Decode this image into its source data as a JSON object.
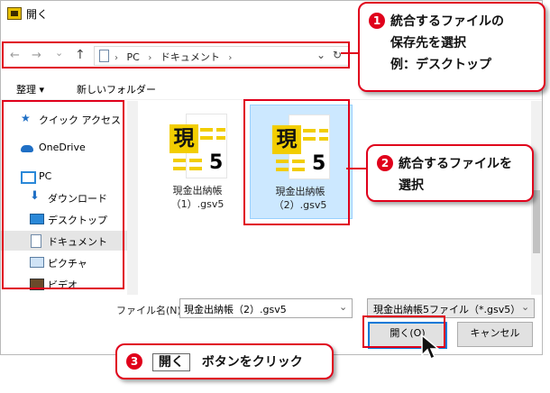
{
  "window": {
    "title": "開く"
  },
  "nav": {
    "back": "←",
    "forward": "→",
    "recent": "⌄",
    "up": "↑",
    "path": [
      "PC",
      "ドキュメント"
    ],
    "sep": "›",
    "dropdown": "⌄",
    "refresh": "↻"
  },
  "toolbar": {
    "organize": "整理 ▾",
    "new_folder": "新しいフォルダー"
  },
  "sidebar": {
    "items": [
      {
        "label": "クイック アクセス",
        "icon": "star-icon"
      },
      {
        "label": "OneDrive",
        "icon": "cloud-icon"
      },
      {
        "label": "PC",
        "icon": "monitor-icon"
      },
      {
        "label": "ダウンロード",
        "icon": "download-arrow-icon"
      },
      {
        "label": "デスクトップ",
        "icon": "desktop-icon"
      },
      {
        "label": "ドキュメント",
        "icon": "document-icon"
      },
      {
        "label": "ピクチャ",
        "icon": "picture-icon"
      },
      {
        "label": "ビデオ",
        "icon": "video-icon"
      }
    ]
  },
  "files": [
    {
      "glyph": "現",
      "digit": "5",
      "name": "現金出納帳（1）.gsv5"
    },
    {
      "glyph": "現",
      "digit": "5",
      "name": "現金出納帳（2）.gsv5"
    }
  ],
  "bottom": {
    "filename_label": "ファイル名(N):",
    "filename_value": "現金出納帳（2）.gsv5",
    "filter_value": "現金出納帳5ファイル（*.gsv5）",
    "open_label": "開く(O)",
    "cancel_label": "キャンセル"
  },
  "annotations": {
    "step1": {
      "num": "1",
      "lines": [
        "統合するファイルの",
        "保存先を選択",
        "例：デスクトップ"
      ]
    },
    "step2": {
      "num": "2",
      "lines": [
        "統合するファイルを",
        "選択"
      ]
    },
    "step3": {
      "num": "3",
      "key": "開く",
      "text": "ボタンをクリック"
    }
  },
  "colors": {
    "annotation_red": "#e0001b",
    "selection": "#cce8ff",
    "accent": "#0078d7",
    "file_icon_yellow": "#f2cd00"
  }
}
